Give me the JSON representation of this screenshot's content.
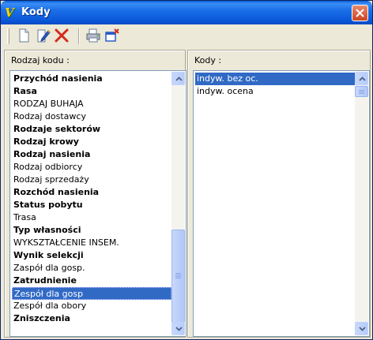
{
  "window": {
    "title": "Kody",
    "app_icon_glyph": "V",
    "close_icon": "close-icon"
  },
  "toolbar": {
    "buttons": [
      {
        "name": "new-document-icon"
      },
      {
        "name": "edit-icon"
      },
      {
        "name": "delete-icon"
      },
      {
        "name": "print-icon"
      },
      {
        "name": "export-icon"
      }
    ]
  },
  "left_pane": {
    "label": "Rodzaj kodu :",
    "items": [
      {
        "text": "Przychód nasienia",
        "bold": true
      },
      {
        "text": "Rasa",
        "bold": true
      },
      {
        "text": "RODZAJ BUHAJA",
        "bold": false
      },
      {
        "text": "Rodzaj dostawcy",
        "bold": false
      },
      {
        "text": "Rodzaje sektorów",
        "bold": true
      },
      {
        "text": "Rodzaj krowy",
        "bold": true
      },
      {
        "text": "Rodzaj nasienia",
        "bold": true
      },
      {
        "text": "Rodzaj odbiorcy",
        "bold": false
      },
      {
        "text": "Rodzaj sprzedaży",
        "bold": false
      },
      {
        "text": "Rozchód nasienia",
        "bold": true
      },
      {
        "text": "Status pobytu",
        "bold": true
      },
      {
        "text": "Trasa",
        "bold": false
      },
      {
        "text": "Typ własności",
        "bold": true
      },
      {
        "text": "WYKSZTAŁCENIE INSEM.",
        "bold": false
      },
      {
        "text": "Wynik selekcji",
        "bold": true
      },
      {
        "text": "Zaspół dla gosp.",
        "bold": false
      },
      {
        "text": "Zatrudnienie",
        "bold": true
      },
      {
        "text": "Zespół dla gosp",
        "bold": false,
        "selected": true
      },
      {
        "text": "Zespół dla obory",
        "bold": false
      },
      {
        "text": "Zniszczenia",
        "bold": true
      }
    ]
  },
  "right_pane": {
    "label": "Kody :",
    "items": [
      {
        "text": "indyw. bez oc.",
        "selected": true
      },
      {
        "text": "indyw. ocena",
        "selected": false
      }
    ]
  },
  "colors": {
    "selection": "#316ac5",
    "title_bar": "#0a56d8",
    "window_bg": "#ece9d8"
  }
}
